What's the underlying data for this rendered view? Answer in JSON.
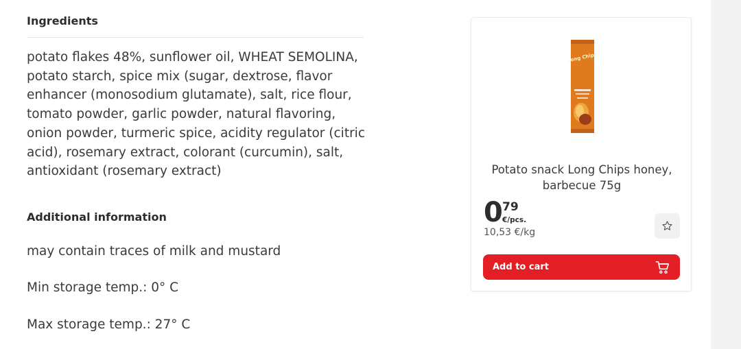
{
  "ingredients": {
    "title": "Ingredients",
    "text": "potato flakes 48%, sunflower oil, WHEAT SEMOLINA, potato starch, spice mix (sugar, dextrose, flavor enhancer (monosodium glutamate), salt, rice flour, tomato powder, garlic powder, natural flavoring, onion powder, turmeric spice, acidity regulator (citric acid), rosemary extract, colorant (curcumin), salt, antioxidant (rosemary extract)"
  },
  "additional": {
    "title": "Additional information",
    "lines": [
      "may contain traces of milk and mustard",
      "Min storage temp.: 0° C",
      "Max storage temp.: 27° C"
    ]
  },
  "product": {
    "name": "Potato snack Long Chips honey, barbecue 75g",
    "package_label": "Long Chips",
    "price_integer": "0",
    "price_cents": "79",
    "price_unit": "€/pcs.",
    "price_per_kg": "10,53 €/kg",
    "add_to_cart_label": "Add to cart",
    "favorite_icon": "star-outline-icon",
    "cart_icon": "shopping-cart-icon"
  },
  "colors": {
    "accent": "#e31e24",
    "package": "#e07a1f"
  }
}
